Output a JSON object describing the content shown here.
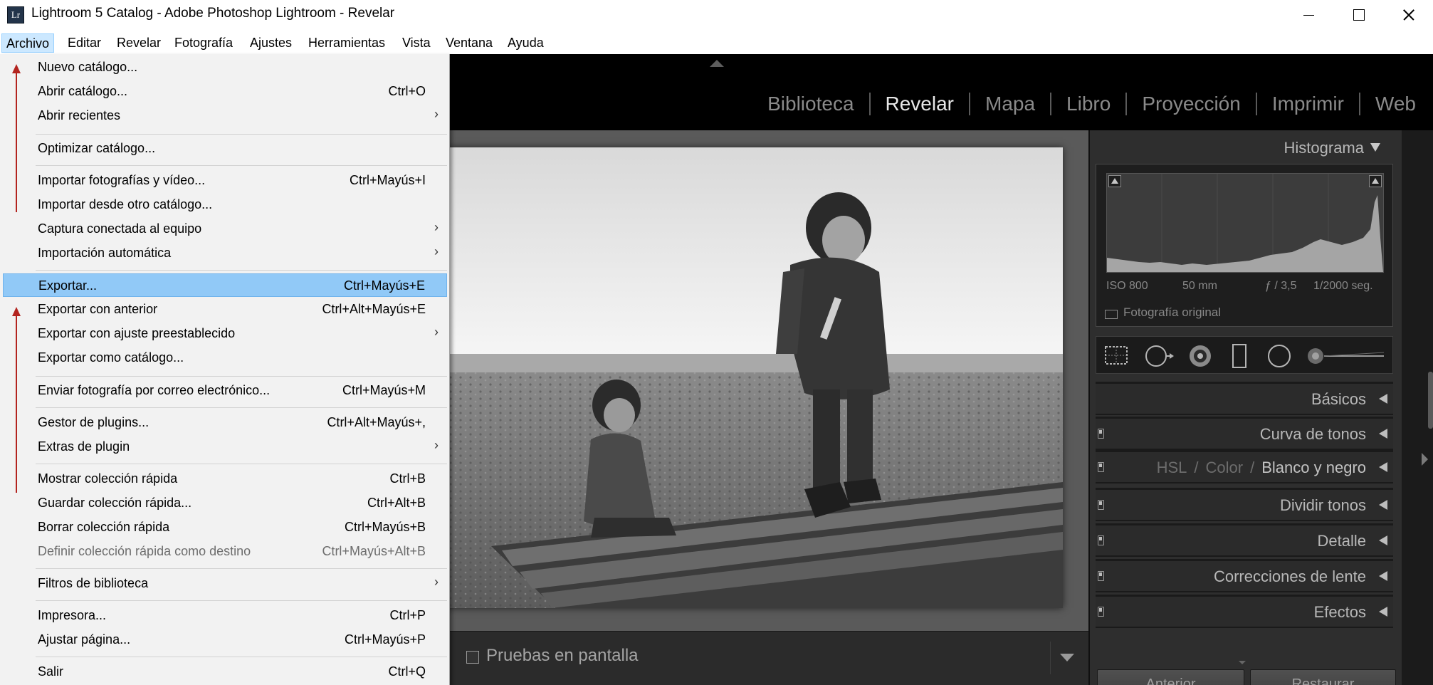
{
  "window": {
    "app_icon": "Lr",
    "title": "Lightroom 5 Catalog - Adobe Photoshop Lightroom - Revelar"
  },
  "menubar": [
    "Archivo",
    "Editar",
    "Revelar",
    "Fotografía",
    "Ajustes",
    "Herramientas",
    "Vista",
    "Ventana",
    "Ayuda"
  ],
  "modules": [
    "Biblioteca",
    "Revelar",
    "Mapa",
    "Libro",
    "Proyección",
    "Imprimir",
    "Web"
  ],
  "active_module": "Revelar",
  "histogram": {
    "title": "Histograma",
    "iso": "ISO 800",
    "focal": "50 mm",
    "aperture": "ƒ / 3,5",
    "shutter": "1/2000 seg.",
    "original_label": "Fotografía original"
  },
  "tools": [
    "crop-overlay-icon",
    "spot-removal-icon",
    "red-eye-icon",
    "graduated-filter-icon",
    "radial-filter-icon",
    "adjustment-brush-slider-icon"
  ],
  "sections": {
    "basicos": "Básicos",
    "curva": "Curva de tonos",
    "hsl": "HSL",
    "color": "Color",
    "byn": "Blanco y negro",
    "dividir": "Dividir tonos",
    "detalle": "Detalle",
    "correcciones": "Correcciones de lente",
    "efectos": "Efectos"
  },
  "buttons": {
    "anterior": "Anterior",
    "restaurar": "Restaurar"
  },
  "toolbar": {
    "proof_label": "Pruebas en pantalla"
  },
  "dropdown": {
    "items": [
      {
        "label": "Nuevo catálogo...",
        "shortcut": "",
        "submenu": false,
        "disabled": false
      },
      {
        "label": "Abrir catálogo...",
        "shortcut": "Ctrl+O",
        "submenu": false,
        "disabled": false
      },
      {
        "label": "Abrir recientes",
        "shortcut": "",
        "submenu": true,
        "disabled": false
      },
      {
        "label": "Optimizar catálogo...",
        "shortcut": "",
        "submenu": false,
        "disabled": false
      },
      {
        "label": "Importar fotografías y vídeo...",
        "shortcut": "Ctrl+Mayús+I",
        "submenu": false,
        "disabled": false
      },
      {
        "label": "Importar desde otro catálogo...",
        "shortcut": "",
        "submenu": false,
        "disabled": false
      },
      {
        "label": "Captura conectada al equipo",
        "shortcut": "",
        "submenu": true,
        "disabled": false
      },
      {
        "label": "Importación automática",
        "shortcut": "",
        "submenu": true,
        "disabled": false
      },
      {
        "label": "Exportar...",
        "shortcut": "Ctrl+Mayús+E",
        "submenu": false,
        "disabled": false,
        "highlighted": true
      },
      {
        "label": "Exportar con anterior",
        "shortcut": "Ctrl+Alt+Mayús+E",
        "submenu": false,
        "disabled": false
      },
      {
        "label": "Exportar con ajuste preestablecido",
        "shortcut": "",
        "submenu": true,
        "disabled": false
      },
      {
        "label": "Exportar como catálogo...",
        "shortcut": "",
        "submenu": false,
        "disabled": false
      },
      {
        "label": "Enviar fotografía por correo electrónico...",
        "shortcut": "Ctrl+Mayús+M",
        "submenu": false,
        "disabled": false
      },
      {
        "label": "Gestor de plugins...",
        "shortcut": "Ctrl+Alt+Mayús+,",
        "submenu": false,
        "disabled": false
      },
      {
        "label": "Extras de plugin",
        "shortcut": "",
        "submenu": true,
        "disabled": false
      },
      {
        "label": "Mostrar colección rápida",
        "shortcut": "Ctrl+B",
        "submenu": false,
        "disabled": false
      },
      {
        "label": "Guardar colección rápida...",
        "shortcut": "Ctrl+Alt+B",
        "submenu": false,
        "disabled": false
      },
      {
        "label": "Borrar colección rápida",
        "shortcut": "Ctrl+Mayús+B",
        "submenu": false,
        "disabled": false
      },
      {
        "label": "Definir colección rápida como destino",
        "shortcut": "Ctrl+Mayús+Alt+B",
        "submenu": false,
        "disabled": true
      },
      {
        "label": "Filtros de biblioteca",
        "shortcut": "",
        "submenu": true,
        "disabled": false
      },
      {
        "label": "Impresora...",
        "shortcut": "Ctrl+P",
        "submenu": false,
        "disabled": false
      },
      {
        "label": "Ajustar página...",
        "shortcut": "Ctrl+Mayús+P",
        "submenu": false,
        "disabled": false
      },
      {
        "label": "Salir",
        "shortcut": "Ctrl+Q",
        "submenu": false,
        "disabled": false
      }
    ]
  },
  "colors": {
    "menu_highlight": "#91c9f7",
    "annotation_arrow": "#b3241f",
    "panel_bg": "#2e2e2e"
  }
}
